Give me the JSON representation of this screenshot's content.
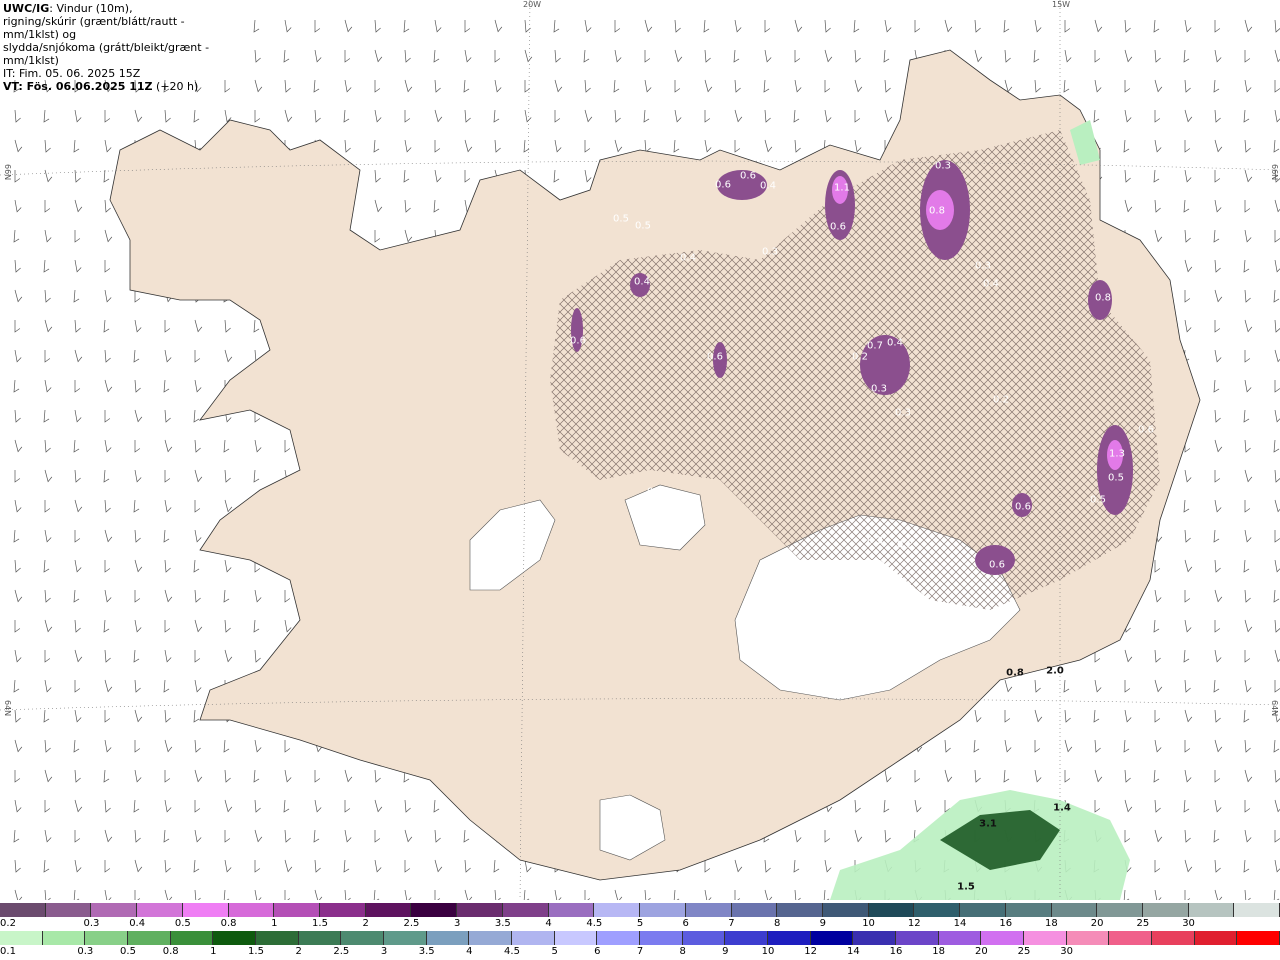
{
  "header": {
    "line1_bold": "UWC/IG",
    "line1_rest": ": Vindur (10m),",
    "line2": "rigning/skúrir (grænt/blátt/rautt - mm/1klst) og",
    "line3": "slydda/snjókoma (grátt/bleikt/grænt - mm/1klst)",
    "line4": "IT: Fim. 05. 06. 2025 15Z",
    "line5_bold": "VT: Fös. 06.06.2025 11Z",
    "line5_rest": " (+20 h)"
  },
  "grid_labels": {
    "top_left": "20W",
    "top_right": "15W",
    "left_upper": "66N",
    "left_lower": "64N",
    "right_upper": "66N",
    "right_lower": "64N"
  },
  "snow_values": [
    "0.5",
    "0.5",
    "0.4",
    "0.4",
    "0.6",
    "0.6",
    "0.4",
    "0.3",
    "1.1",
    "0.6",
    "0.3",
    "0.8",
    "0.3",
    "0.4",
    "0.8",
    "0.6",
    "0.6",
    "0.7",
    "0.4",
    "0.2",
    "0.3",
    "0.3",
    "0.2",
    "0.2",
    "0.3",
    "0.2",
    "0.6",
    "0.6",
    "1.3",
    "0.5",
    "0.6",
    "0.5"
  ],
  "rain_values": [
    "0.8",
    "2.0",
    "3.1",
    "1.4",
    "1.5"
  ],
  "colorbars": {
    "snow_colors": [
      "#6b4b6e",
      "#8a5c8e",
      "#b06ab4",
      "#d275d8",
      "#ef7ef4",
      "#d66ad9",
      "#b44fb6",
      "#8b2f8c",
      "#5e135f",
      "#3a0040",
      "#6a2c6e",
      "#7f3f8a",
      "#9a6ec0",
      "#b7b7f4",
      "#9da3e0",
      "#8086c6",
      "#6a73ad",
      "#556590",
      "#3f5977",
      "#1f4a59",
      "#2f5f6c",
      "#466f77",
      "#587d80",
      "#6d8a8b",
      "#819896",
      "#95a6a2",
      "#b6c4c0",
      "#dbe3e0"
    ],
    "snow_ticks": [
      "0.2",
      "0.3",
      "0.4",
      "0.5",
      "0.8",
      "1",
      "1.5",
      "2",
      "2.5",
      "3",
      "3.5",
      "4",
      "4.5",
      "5",
      "6",
      "7",
      "8",
      "9",
      "10",
      "12",
      "14",
      "16",
      "18",
      "20",
      "25",
      "30"
    ],
    "rain_colors": [
      "#c8f5c8",
      "#a8e8a8",
      "#88d088",
      "#60b060",
      "#3a8f3a",
      "#0e5a0e",
      "#2d6d37",
      "#3c7b55",
      "#4d8a70",
      "#5f9a8a",
      "#7b9fbe",
      "#95a9d5",
      "#b0b5f0",
      "#c8c8ff",
      "#9f9fff",
      "#7b7bef",
      "#5c5cdf",
      "#3d3dcf",
      "#1e1ebf",
      "#00009f",
      "#3a2fb0",
      "#6c45c8",
      "#9e5ce0",
      "#d170f0",
      "#f590e0",
      "#f58cb8",
      "#f0608a",
      "#e8405d",
      "#e01f2f",
      "#ff0000"
    ],
    "rain_ticks": [
      "0.1",
      "0.3",
      "0.5",
      "0.8",
      "1",
      "1.5",
      "2",
      "2.5",
      "3",
      "3.5",
      "4",
      "4.5",
      "5",
      "6",
      "7",
      "8",
      "9",
      "10",
      "12",
      "14",
      "16",
      "18",
      "20",
      "25",
      "30"
    ]
  }
}
